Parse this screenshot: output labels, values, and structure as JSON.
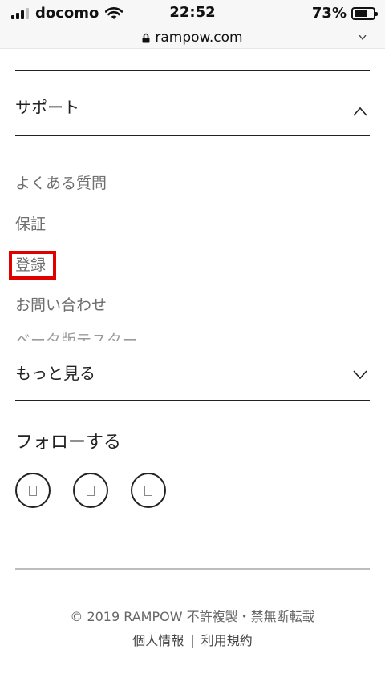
{
  "status_bar": {
    "carrier": "docomo",
    "time": "22:52",
    "battery": "73%",
    "battery_level": 0.73
  },
  "url_bar": {
    "url": "rampow.com",
    "lock_icon": "lock-icon"
  },
  "support_section": {
    "title": "サポート",
    "expanded": true,
    "items": [
      {
        "label": "よくある質問"
      },
      {
        "label": "保証"
      },
      {
        "label": "登録"
      },
      {
        "label": "お問い合わせ"
      },
      {
        "label": "ベータ版テスター"
      }
    ]
  },
  "more_section": {
    "title": "もっと見る",
    "expanded": false
  },
  "follow": {
    "title": "フォローする",
    "icons": [
      "social-icon",
      "social-icon",
      "social-icon"
    ]
  },
  "footer": {
    "copyright": "© 2019 RAMPOW 不許複製・禁無断転載",
    "links": [
      {
        "label": "個人情報"
      },
      {
        "label": "利用規約"
      }
    ],
    "separator": "|"
  },
  "colors": {
    "highlight": "#e00000",
    "text_primary": "#222222",
    "text_secondary": "#6f6f6f"
  }
}
